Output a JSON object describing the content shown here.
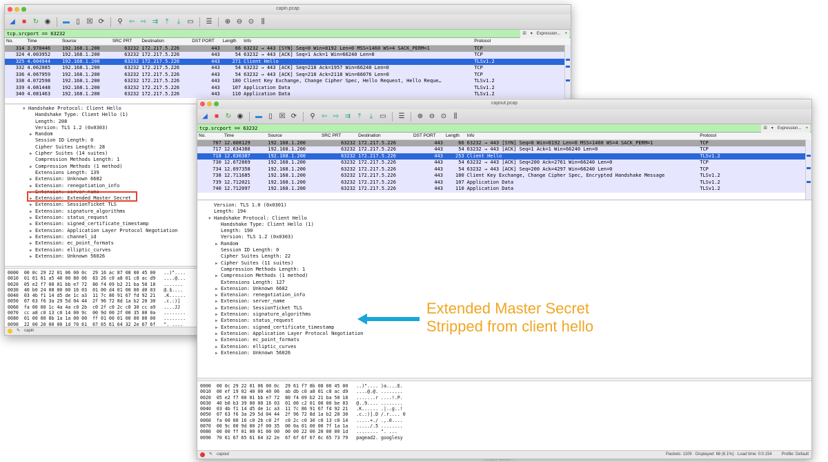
{
  "win1": {
    "title": "capin.pcap",
    "filter": "tcp.srcport == 63232",
    "filter_expr": "Expression...",
    "filter_plus": "+",
    "columns": [
      "No.",
      "Time",
      "Source",
      "SRC PRT",
      "Destination",
      "DST PORT",
      "Length",
      "Info",
      "Protocol"
    ],
    "rows": [
      {
        "no": "314",
        "time": "3.970446",
        "src": "192.168.1.200",
        "sport": "63232",
        "dst": "172.217.5.226",
        "dport": "443",
        "len": "66",
        "info": "63232 → 443 [SYN] Seq=0 Win=8192 Len=0 MSS=1460 WS=4 SACK_PERM=1",
        "proto": "TCP",
        "style": "syn"
      },
      {
        "no": "324",
        "time": "4.003952",
        "src": "192.168.1.200",
        "sport": "63232",
        "dst": "172.217.5.226",
        "dport": "443",
        "len": "54",
        "info": "63232 → 443 [ACK] Seq=1 Ack=1 Win=66240 Len=0",
        "proto": "TCP",
        "style": "tcp"
      },
      {
        "no": "325",
        "time": "4.004944",
        "src": "192.168.1.200",
        "sport": "63232",
        "dst": "172.217.5.226",
        "dport": "443",
        "len": "271",
        "info": "Client Hello",
        "proto": "TLSv1.2",
        "style": "sel"
      },
      {
        "no": "332",
        "time": "4.062085",
        "src": "192.168.1.200",
        "sport": "63232",
        "dst": "172.217.5.226",
        "dport": "443",
        "len": "54",
        "info": "63232 → 443 [ACK] Seq=218 Ack=1957 Win=66240 Len=0",
        "proto": "TCP",
        "style": "tcp"
      },
      {
        "no": "336",
        "time": "4.067959",
        "src": "192.168.1.200",
        "sport": "63232",
        "dst": "172.217.5.226",
        "dport": "443",
        "len": "54",
        "info": "63232 → 443 [ACK] Seq=218 Ack=2118 Win=66076 Len=0",
        "proto": "TCP",
        "style": "tcp"
      },
      {
        "no": "338",
        "time": "4.072598",
        "src": "192.168.1.200",
        "sport": "63232",
        "dst": "172.217.5.226",
        "dport": "443",
        "len": "180",
        "info": "Client Key Exchange, Change Cipher Spec, Hello Request, Hello Reque…",
        "proto": "TLSv1.2",
        "style": "tls"
      },
      {
        "no": "339",
        "time": "4.081448",
        "src": "192.168.1.200",
        "sport": "63232",
        "dst": "172.217.5.226",
        "dport": "443",
        "len": "107",
        "info": "Application Data",
        "proto": "TLSv1.2",
        "style": "tls"
      },
      {
        "no": "340",
        "time": "4.081463",
        "src": "192.168.1.200",
        "sport": "63232",
        "dst": "172.217.5.226",
        "dport": "443",
        "len": "110",
        "info": "Application Data",
        "proto": "TLSv1.2",
        "style": "tls"
      }
    ],
    "details": [
      {
        "t": "Handshake Protocol: Client Hello",
        "i": 2,
        "a": "open"
      },
      {
        "t": "Handshake Type: Client Hello (1)",
        "i": 3,
        "a": ""
      },
      {
        "t": "Length: 208",
        "i": 3,
        "a": ""
      },
      {
        "t": "Version: TLS 1.2 (0x0303)",
        "i": 3,
        "a": ""
      },
      {
        "t": "Random",
        "i": 3,
        "a": "closed"
      },
      {
        "t": "Session ID Length: 0",
        "i": 3,
        "a": ""
      },
      {
        "t": "Cipher Suites Length: 28",
        "i": 3,
        "a": ""
      },
      {
        "t": "Cipher Suites (14 suites)",
        "i": 3,
        "a": "closed"
      },
      {
        "t": "Compression Methods Length: 1",
        "i": 3,
        "a": ""
      },
      {
        "t": "Compression Methods (1 method)",
        "i": 3,
        "a": "closed"
      },
      {
        "t": "Extensions Length: 139",
        "i": 3,
        "a": ""
      },
      {
        "t": "Extension: Unknown 6682",
        "i": 3,
        "a": "closed"
      },
      {
        "t": "Extension: renegotiation_info",
        "i": 3,
        "a": "closed"
      },
      {
        "t": "Extension: server_name",
        "i": 3,
        "a": "closed"
      },
      {
        "t": "Extension: Extended Master Secret",
        "i": 3,
        "a": "closed"
      },
      {
        "t": "Extension: SessionTicket TLS",
        "i": 3,
        "a": "closed"
      },
      {
        "t": "Extension: signature_algorithms",
        "i": 3,
        "a": "closed"
      },
      {
        "t": "Extension: status_request",
        "i": 3,
        "a": "closed"
      },
      {
        "t": "Extension: signed_certificate_timestamp",
        "i": 3,
        "a": "closed"
      },
      {
        "t": "Extension: Application Layer Protocol Negotiation",
        "i": 3,
        "a": "closed"
      },
      {
        "t": "Extension: channel_id",
        "i": 3,
        "a": "closed"
      },
      {
        "t": "Extension: ec_point_formats",
        "i": 3,
        "a": "closed"
      },
      {
        "t": "Extension: elliptic_curves",
        "i": 3,
        "a": "closed"
      },
      {
        "t": "Extension: Unknown 56026",
        "i": 3,
        "a": "closed"
      }
    ],
    "hex": [
      "0000  00 0c 29 22 01 06 00 0c  29 16 ac 87 08 00 45 00   ..)\"....",
      "0010  01 01 01 a5 40 00 80 06  83 26 c0 a8 01 c8 ac d9   ....@...",
      "0020  05 e2 f7 00 01 bb e7 72  80 f4 09 b2 21 ba 50 18   .......",
      "0030  40 b0 24 08 00 00 16 03  01 00 d4 01 00 00 d0 03   @.$....",
      "0040  03 4b f1 14 d5 de 1c a3  11 7c 86 91 67 fd 92 21   .K......",
      "0050  07 63 f6 3a 29 5d 04 44  2f 96 72 8d 1a b2 20 30   .c.:)]",
      "0060  fa 00 00 1c 4a 4a c0 2b  c0 2f c0 2c c0 30 cc a9   ....JJ",
      "0070  cc a8 c0 13 c0 14 00 9c  00 9d 00 2f 00 35 00 0a   ........",
      "0080  01 00 00 8b 1a 1a 00 00  ff 01 00 01 00 00 00 00   ........",
      "0090  22 00 20 00 00 1d 70 61  67 65 61 64 32 2e 67 6f   \". ...."
    ],
    "status_label": "capin"
  },
  "win2": {
    "title": "capout.pcap",
    "filter": "tcp.srcport == 63232",
    "filter_expr": "Expression...",
    "filter_plus": "+",
    "columns": [
      "No.",
      "Time",
      "Source",
      "SRC PRT",
      "Destination",
      "DST PORT",
      "Length",
      "Info",
      "Protocol"
    ],
    "rows": [
      {
        "no": "707",
        "time": "12.608129",
        "src": "192.168.1.200",
        "sport": "63232",
        "dst": "172.217.5.226",
        "dport": "443",
        "len": "66",
        "info": "63232 → 443 [SYN] Seq=0 Win=8192 Len=0 MSS=1460 WS=4 SACK_PERM=1",
        "proto": "TCP",
        "style": "syn"
      },
      {
        "no": "717",
        "time": "12.634388",
        "src": "192.168.1.200",
        "sport": "63232",
        "dst": "172.217.5.226",
        "dport": "443",
        "len": "54",
        "info": "63232 → 443 [ACK] Seq=1 Ack=1 Win=66240 Len=0",
        "proto": "TCP",
        "style": "tcp"
      },
      {
        "no": "718",
        "time": "12.636387",
        "src": "192.168.1.200",
        "sport": "63232",
        "dst": "172.217.5.226",
        "dport": "443",
        "len": "253",
        "info": "Client Hello",
        "proto": "TLSv1.2",
        "style": "sel"
      },
      {
        "no": "730",
        "time": "12.672869",
        "src": "192.168.1.200",
        "sport": "63232",
        "dst": "172.217.5.226",
        "dport": "443",
        "len": "54",
        "info": "63232 → 443 [ACK] Seq=200 Ack=2761 Win=66240 Len=0",
        "proto": "TCP",
        "style": "tcp"
      },
      {
        "no": "734",
        "time": "12.697358",
        "src": "192.168.1.200",
        "sport": "63232",
        "dst": "172.217.5.226",
        "dport": "443",
        "len": "54",
        "info": "63232 → 443 [ACK] Seq=200 Ack=4297 Win=66240 Len=0",
        "proto": "TCP",
        "style": "tcp"
      },
      {
        "no": "738",
        "time": "12.711685",
        "src": "192.168.1.200",
        "sport": "63232",
        "dst": "172.217.5.226",
        "dport": "443",
        "len": "180",
        "info": "Client Key Exchange, Change Cipher Spec, Encrypted Handshake Message",
        "proto": "TLSv1.2",
        "style": "tls"
      },
      {
        "no": "739",
        "time": "12.712021",
        "src": "192.168.1.200",
        "sport": "63232",
        "dst": "172.217.5.226",
        "dport": "443",
        "len": "107",
        "info": "Application Data",
        "proto": "TLSv1.2",
        "style": "tls"
      },
      {
        "no": "740",
        "time": "12.712097",
        "src": "192.168.1.200",
        "sport": "63232",
        "dst": "172.217.5.226",
        "dport": "443",
        "len": "110",
        "info": "Application Data",
        "proto": "TLSv1.2",
        "style": "tls"
      }
    ],
    "details": [
      {
        "t": "Version: TLS 1.0 (0x0301)",
        "i": 1,
        "a": ""
      },
      {
        "t": "Length: 194",
        "i": 1,
        "a": ""
      },
      {
        "t": "Handshake Protocol: Client Hello",
        "i": 1,
        "a": "open"
      },
      {
        "t": "Handshake Type: Client Hello (1)",
        "i": 2,
        "a": ""
      },
      {
        "t": "Length: 190",
        "i": 2,
        "a": ""
      },
      {
        "t": "Version: TLS 1.2 (0x0303)",
        "i": 2,
        "a": ""
      },
      {
        "t": "Random",
        "i": 2,
        "a": "closed"
      },
      {
        "t": "Session ID Length: 0",
        "i": 2,
        "a": ""
      },
      {
        "t": "Cipher Suites Length: 22",
        "i": 2,
        "a": ""
      },
      {
        "t": "Cipher Suites (11 suites)",
        "i": 2,
        "a": "closed"
      },
      {
        "t": "Compression Methods Length: 1",
        "i": 2,
        "a": ""
      },
      {
        "t": "Compression Methods (1 method)",
        "i": 2,
        "a": "closed"
      },
      {
        "t": "Extensions Length: 127",
        "i": 2,
        "a": ""
      },
      {
        "t": "Extension: Unknown 6682",
        "i": 2,
        "a": "closed"
      },
      {
        "t": "Extension: renegotiation_info",
        "i": 2,
        "a": "closed"
      },
      {
        "t": "Extension: server_name",
        "i": 2,
        "a": "closed"
      },
      {
        "t": "Extension: SessionTicket TLS",
        "i": 2,
        "a": "closed"
      },
      {
        "t": "Extension: signature_algorithms",
        "i": 2,
        "a": "closed"
      },
      {
        "t": "Extension: status_request",
        "i": 2,
        "a": "closed"
      },
      {
        "t": "Extension: signed_certificate_timestamp",
        "i": 2,
        "a": "closed"
      },
      {
        "t": "Extension: Application Layer Protocol Negotiation",
        "i": 2,
        "a": "closed"
      },
      {
        "t": "Extension: ec_point_formats",
        "i": 2,
        "a": "closed"
      },
      {
        "t": "Extension: elliptic_curves",
        "i": 2,
        "a": "closed"
      },
      {
        "t": "Extension: Unknown 56026",
        "i": 2,
        "a": "closed"
      }
    ],
    "hex": [
      "0000  00 0c 29 22 01 06 00 0c  29 61 f7 8b 08 00 45 00   ..)\".... )a....E.",
      "0010  00 ef 19 02 40 00 40 06  ab db c0 a8 01 c8 ac d9   ....@.@. ........",
      "0020  05 e2 f7 00 01 bb e7 72  80 f4 09 b2 21 ba 50 18   .......r ....!.P.",
      "0030  40 b0 b3 39 00 00 16 03  01 00 c2 01 00 00 be 03   @..9.... ........",
      "0040  03 4b f1 14 d5 de 1c a3  11 7c 86 91 67 fd 92 21   .K...... .|..g..!",
      "0050  07 63 f6 3a 29 5d 04 44  2f 96 72 8d 1a b2 20 30   .c.:)].D /.r.... 0",
      "0060  fa 00 00 16 c0 2b c0 2f  c0 2c c0 30 c0 13 c0 14   .....+./ .,.0....",
      "0070  00 9c 00 9d 00 2f 00 35  00 0a 01 00 00 7f 1a 1a   ...../.5 ........",
      "0080  00 00 ff 01 00 01 00 00  00 00 22 00 20 00 00 1d   ........ \". ...",
      "0090  70 61 67 65 61 64 32 2e  67 6f 6f 67 6c 65 73 79   pagead2. googlesy"
    ],
    "status_label": "capout",
    "status_stats": "Packets: 1109 · Displayed: 68 (6.1%) · Load time: 0:0.154",
    "status_profile": "Profile: Default"
  },
  "callout": {
    "line1": "Extended Master Secret",
    "line2": "Stripped from client hello",
    "color": "#f0a623",
    "arrow_color": "#1aa6d8",
    "box_color": "#e0432f"
  },
  "footnote": "7E5BCF48014..."
}
